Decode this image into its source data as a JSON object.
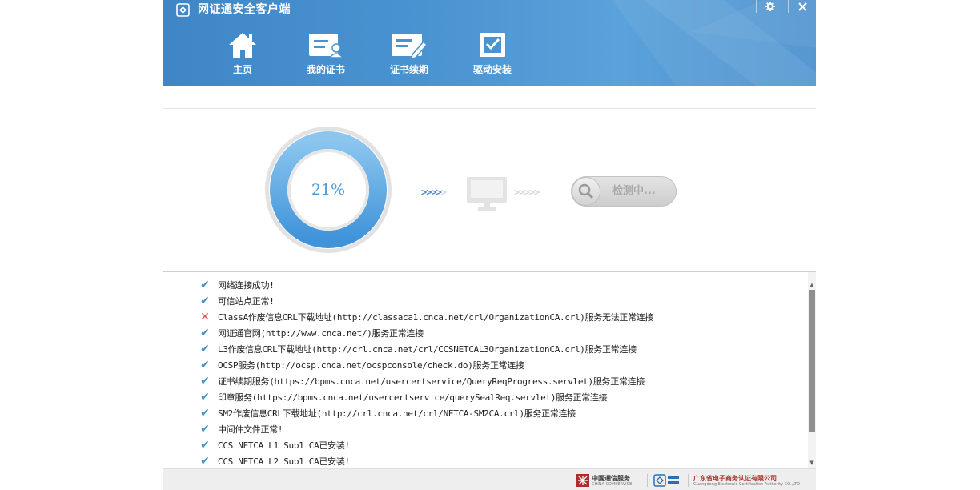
{
  "window": {
    "title": "网证通安全客户端",
    "settings_icon": "gear-icon",
    "close_icon": "close-icon"
  },
  "nav": {
    "items": [
      {
        "label": "主页",
        "icon": "home-icon"
      },
      {
        "label": "我的证书",
        "icon": "certificate-user-icon"
      },
      {
        "label": "证书续期",
        "icon": "certificate-renew-icon"
      },
      {
        "label": "驱动安装",
        "icon": "driver-install-icon"
      }
    ]
  },
  "status": {
    "progress_text": "21%",
    "progress_value": 0.21,
    "arrow_left": ">>>>",
    "arrow_left_faded": ">",
    "arrow_right": ">>>>>",
    "detect_label": "检测中...",
    "detect_icon": "search-icon"
  },
  "log": {
    "rows": [
      {
        "status": "ok",
        "text": "网络连接成功!"
      },
      {
        "status": "ok",
        "text": "可信站点正常!"
      },
      {
        "status": "error",
        "text": "ClassA作废信息CRL下载地址(http://classaca1.cnca.net/crl/OrganizationCA.crl)服务无法正常连接"
      },
      {
        "status": "ok",
        "text": "网证通官网(http://www.cnca.net/)服务正常连接"
      },
      {
        "status": "ok",
        "text": "L3作废信息CRL下载地址(http://crl.cnca.net/crl/CCSNETCAL3OrganizationCA.crl)服务正常连接"
      },
      {
        "status": "ok",
        "text": "OCSP服务(http://ocsp.cnca.net/ocspconsole/check.do)服务正常连接"
      },
      {
        "status": "ok",
        "text": "证书续期服务(https://bpms.cnca.net/usercertservice/QueryReqProgress.servlet)服务正常连接"
      },
      {
        "status": "ok",
        "text": "印章服务(https://bpms.cnca.net/usercertservice/querySealReq.servlet)服务正常连接"
      },
      {
        "status": "ok",
        "text": "SM2作废信息CRL下载地址(http://crl.cnca.net/crl/NETCA-SM2CA.crl)服务正常连接"
      },
      {
        "status": "ok",
        "text": "中间件文件正常!"
      },
      {
        "status": "ok",
        "text": "CCS NETCA L1 Sub1 CA已安装!"
      },
      {
        "status": "ok",
        "text": "CCS NETCA L2 Sub1 CA已安装!"
      }
    ]
  },
  "footer": {
    "partner1_name": "中国通信服务",
    "partner1_sub": "CHINA COMSERVICE",
    "partner2_logo": "netca-logo",
    "partner3_name": "广东省电子商务认证有限公司",
    "partner3_sub": "Guangdong Electronic Certification Authority CO.,LTD"
  },
  "colors": {
    "header": "#4a93d1",
    "accent": "#3d8fd0",
    "error": "#e14d3f"
  }
}
